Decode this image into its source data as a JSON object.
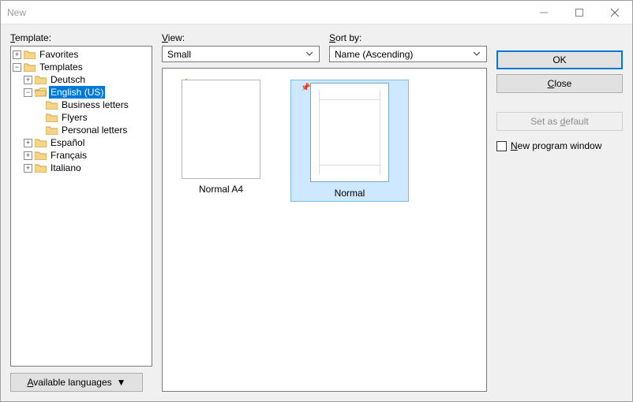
{
  "window": {
    "title": "New"
  },
  "labels": {
    "template": "Template:",
    "view": "View:",
    "sort": "Sort by:",
    "languages": "Available languages"
  },
  "view": {
    "selected": "Small"
  },
  "sort": {
    "selected": "Name (Ascending)"
  },
  "tree": {
    "favorites": "Favorites",
    "templates": "Templates",
    "deutsch": "Deutsch",
    "english": "English (US)",
    "business": "Business letters",
    "flyers": "Flyers",
    "personal": "Personal letters",
    "espanol": "Español",
    "francais": "Français",
    "italiano": "Italiano"
  },
  "gallery": {
    "items": [
      {
        "caption": "Normal A4",
        "selected": false
      },
      {
        "caption": "Normal",
        "selected": true
      }
    ]
  },
  "buttons": {
    "ok": "OK",
    "close": "Close",
    "set_default": "Set as default"
  },
  "checkbox": {
    "new_window": "New program window",
    "checked": false
  }
}
